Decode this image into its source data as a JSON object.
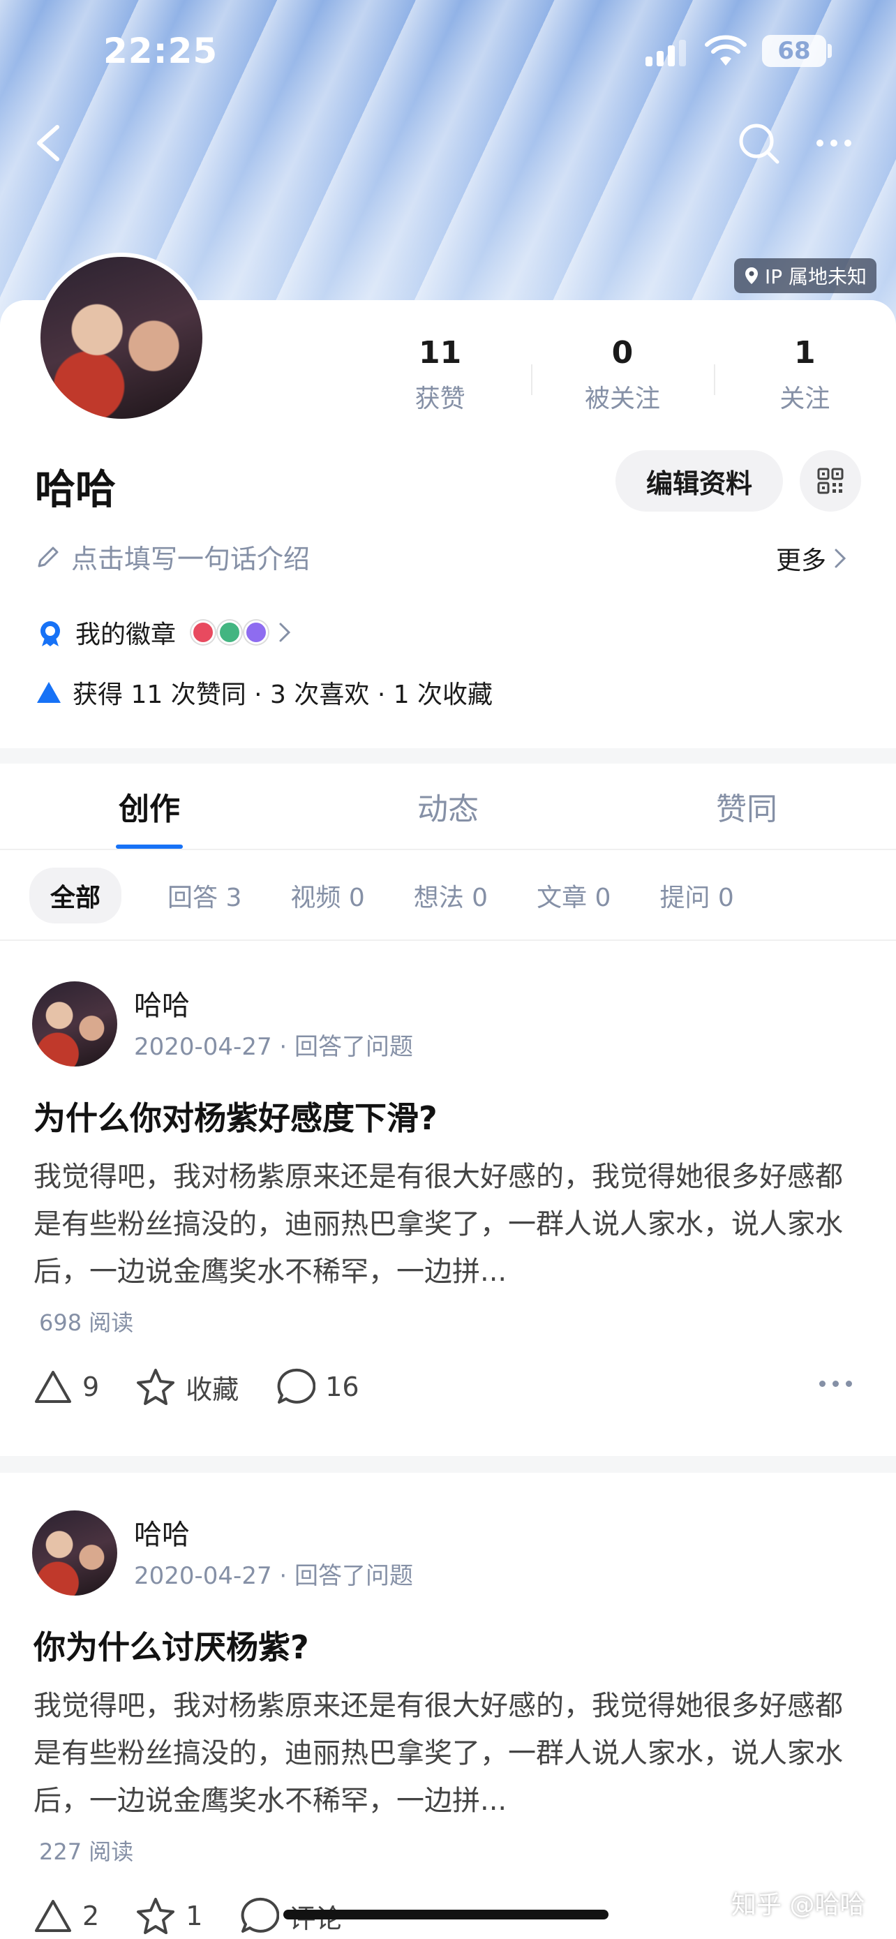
{
  "status_bar": {
    "time": "22:25",
    "battery": "68"
  },
  "header": {
    "ip_badge": "IP 属地未知"
  },
  "profile": {
    "name": "哈哈",
    "edit_label": "编辑资料",
    "bio_placeholder": "点击填写一句话介绍",
    "more_label": "更多",
    "badge_label": "我的徽章",
    "achievement": "获得 11 次赞同 · 3 次喜欢 · 1 次收藏",
    "stats": [
      {
        "num": "11",
        "label": "获赞"
      },
      {
        "num": "0",
        "label": "被关注"
      },
      {
        "num": "1",
        "label": "关注"
      }
    ]
  },
  "tabs": [
    "创作",
    "动态",
    "赞同"
  ],
  "filters": [
    "全部",
    "回答 3",
    "视频 0",
    "想法 0",
    "文章 0",
    "提问 0"
  ],
  "posts": [
    {
      "author": "哈哈",
      "meta": "2020-04-27 · 回答了问题",
      "title": "为什么你对杨紫好感度下滑?",
      "excerpt": "我觉得吧，我对杨紫原来还是有很大好感的，我觉得她很多好感都是有些粉丝搞没的，迪丽热巴拿奖了，一群人说人家水，说人家水后，一边说金鹰奖水不稀罕，一边拼...",
      "reads": "698 阅读",
      "likes": "9",
      "collect": "收藏",
      "comments": "16"
    },
    {
      "author": "哈哈",
      "meta": "2020-04-27 · 回答了问题",
      "title": "你为什么讨厌杨紫?",
      "excerpt": "我觉得吧，我对杨紫原来还是有很大好感的，我觉得她很多好感都是有些粉丝搞没的，迪丽热巴拿奖了，一群人说人家水，说人家水后，一边说金鹰奖水不稀罕，一边拼...",
      "reads": "227 阅读",
      "likes": "2",
      "collect": "1",
      "comments": "评论"
    }
  ],
  "watermark": "知乎 @哈哈",
  "colors": {
    "accent": "#1772f6",
    "muted": "#8590a6"
  }
}
